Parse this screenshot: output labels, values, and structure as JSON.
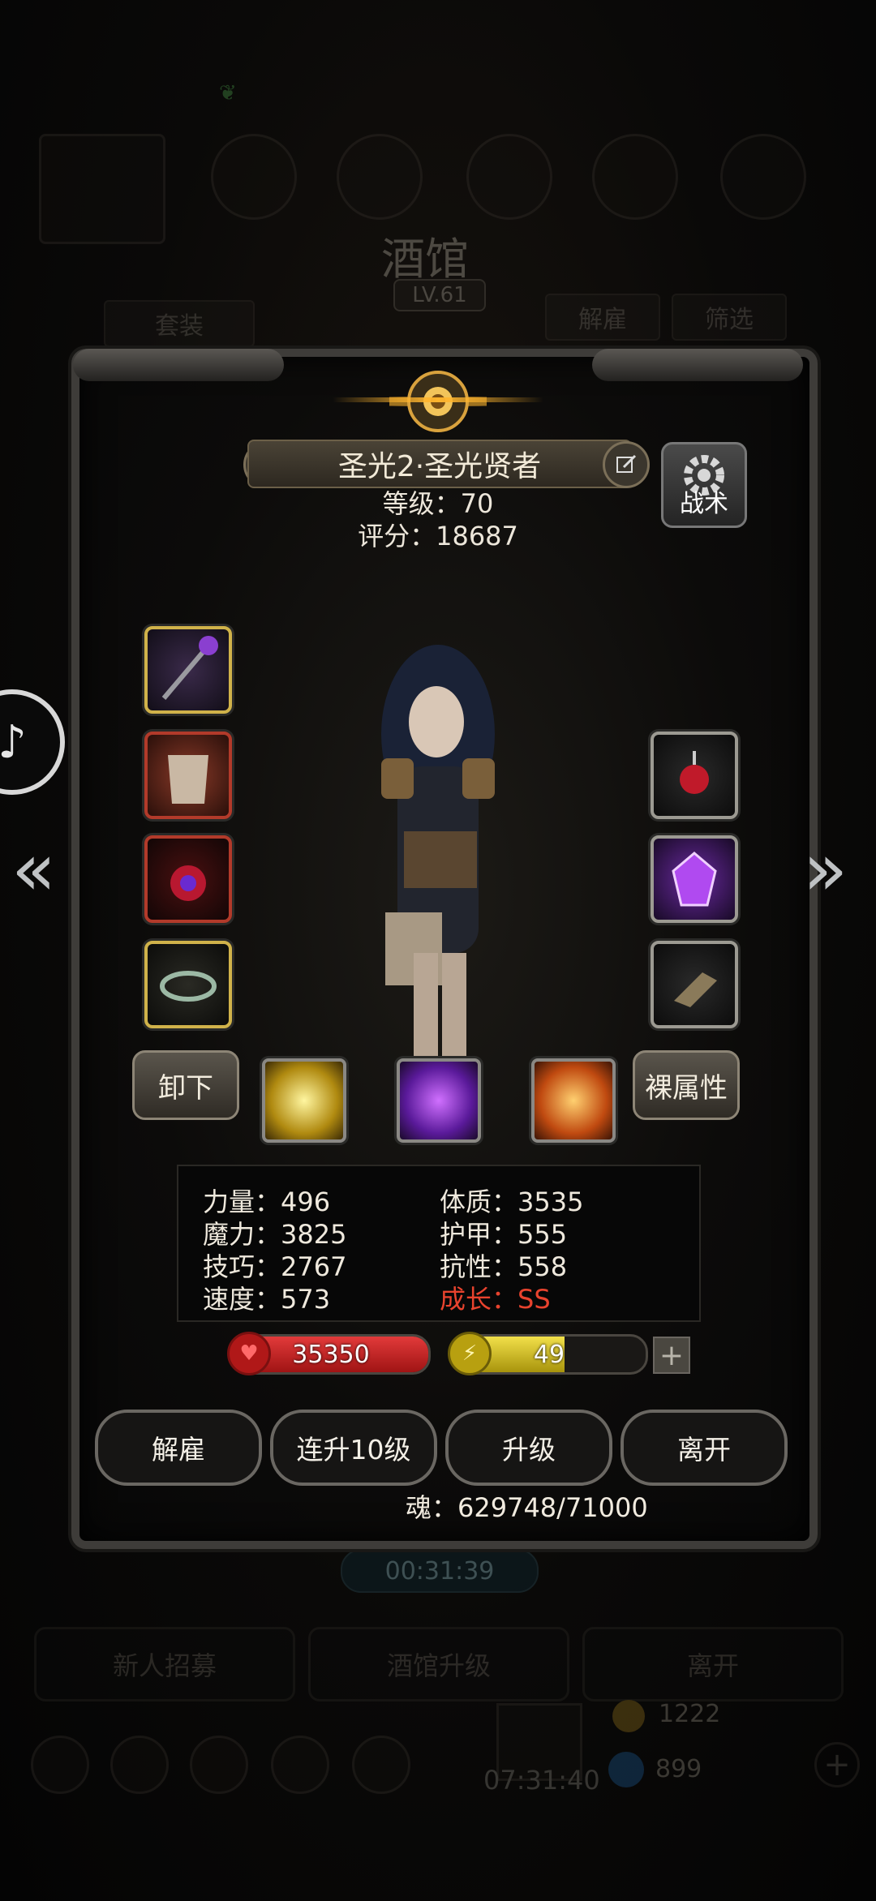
{
  "background": {
    "title": "酒馆",
    "level": "LV.61",
    "set_label": "套装",
    "dismiss_label": "解雇",
    "filter_label": "筛选",
    "timer": "00:31:39",
    "recruit_label": "新人招募",
    "upgrade_tavern_label": "酒馆升级",
    "leave_label": "离开",
    "bottom_timer": "07:31:40",
    "coin_count": "1222",
    "gem_count": "899"
  },
  "hero": {
    "name": "圣光2·圣光贤者",
    "level_text": "等级：70",
    "score_text": "评分：18687"
  },
  "tactics_label": "战术",
  "buttons": {
    "unequip": "卸下",
    "naked_attr": "裸属性"
  },
  "equipment": {
    "left": [
      "staff-icon",
      "armor-icon",
      "amulet-icon",
      "ring-icon"
    ],
    "right": [
      "ruby-pendant-icon",
      "purple-gem-icon",
      "gauntlet-icon"
    ]
  },
  "skills": [
    "light-burst-icon",
    "purple-rune-icon",
    "holy-shield-icon"
  ],
  "stats": {
    "strength": "力量：496",
    "magic": "魔力：3825",
    "skill": "技巧：2767",
    "speed": "速度：573",
    "constitution": "体质：3535",
    "armor": "护甲：555",
    "resistance": "抗性：558",
    "growth": "成长：SS"
  },
  "hp": {
    "value": "35350",
    "fill_fraction": 1.0
  },
  "energy": {
    "value": "49",
    "fill_fraction": 0.58
  },
  "actions": {
    "dismiss": "解雇",
    "level_up_10": "连升10级",
    "level_up": "升级",
    "leave": "离开"
  },
  "soul_text": "魂：629748/71000",
  "colors": {
    "hp_fill": "#c81e1e",
    "energy_fill": "#d9c51f",
    "growth_text": "#e8432e",
    "gold_border": "#d0b24a"
  }
}
